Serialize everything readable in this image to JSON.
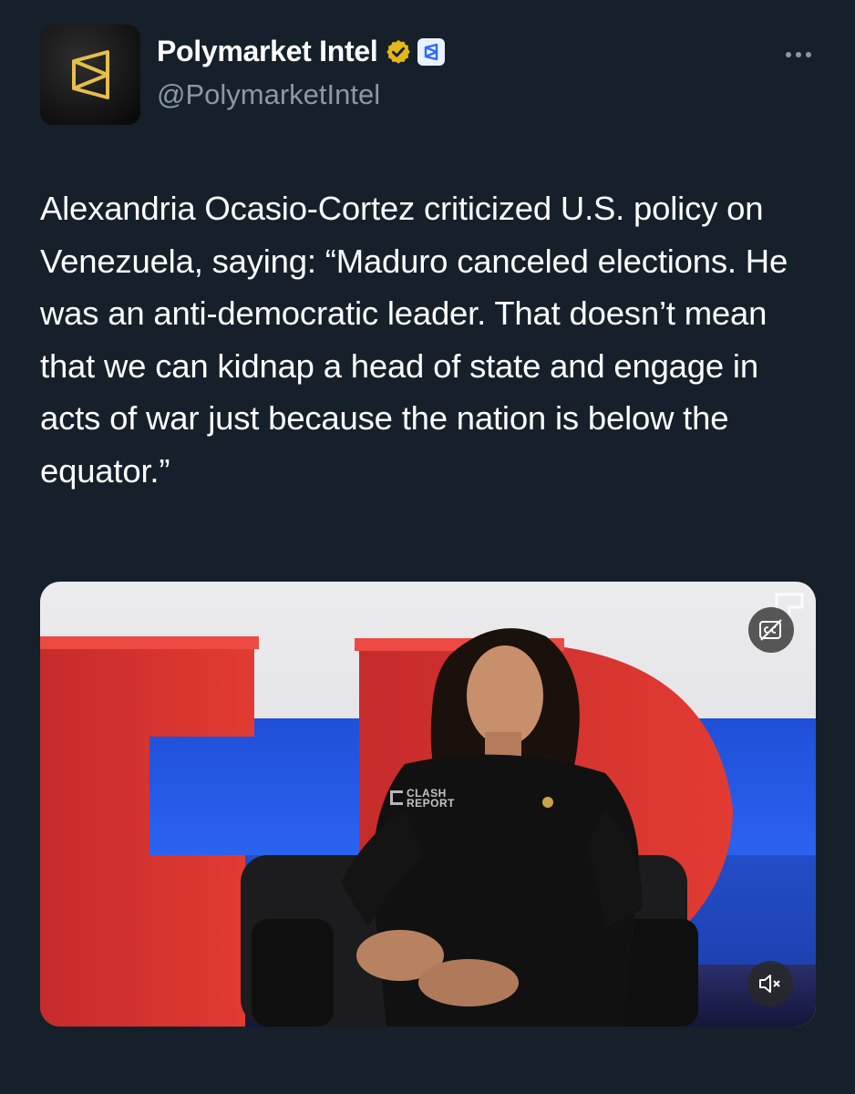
{
  "author": {
    "display_name": "Polymarket Intel",
    "handle": "@PolymarketIntel",
    "verified_badge_icon": "verified-gold-check-icon",
    "affiliate_badge_icon": "polymarket-affiliate-icon",
    "avatar_icon": "polymarket-logo-icon"
  },
  "more_menu_icon": "more-dots-icon",
  "tweet": {
    "text": "Alexandria Ocasio-Cortez criticized U.S. policy on Venezuela, saying: “Maduro canceled elections. He was an anti-democratic leader. That doesn’t mean that we can kidnap a head of state and engage in acts of war just because the nation is below the equator.”"
  },
  "media": {
    "type": "video",
    "captions_icon": "closed-captions-icon",
    "mute_icon": "muted-speaker-icon",
    "watermark_line1": "CLASH",
    "watermark_line2": "REPORT"
  },
  "colors": {
    "background": "#15202b",
    "text_primary": "#ffffff",
    "text_secondary": "#8b98a5",
    "verified_gold": "#e2b719",
    "accent_blue": "#1d9bf0"
  }
}
